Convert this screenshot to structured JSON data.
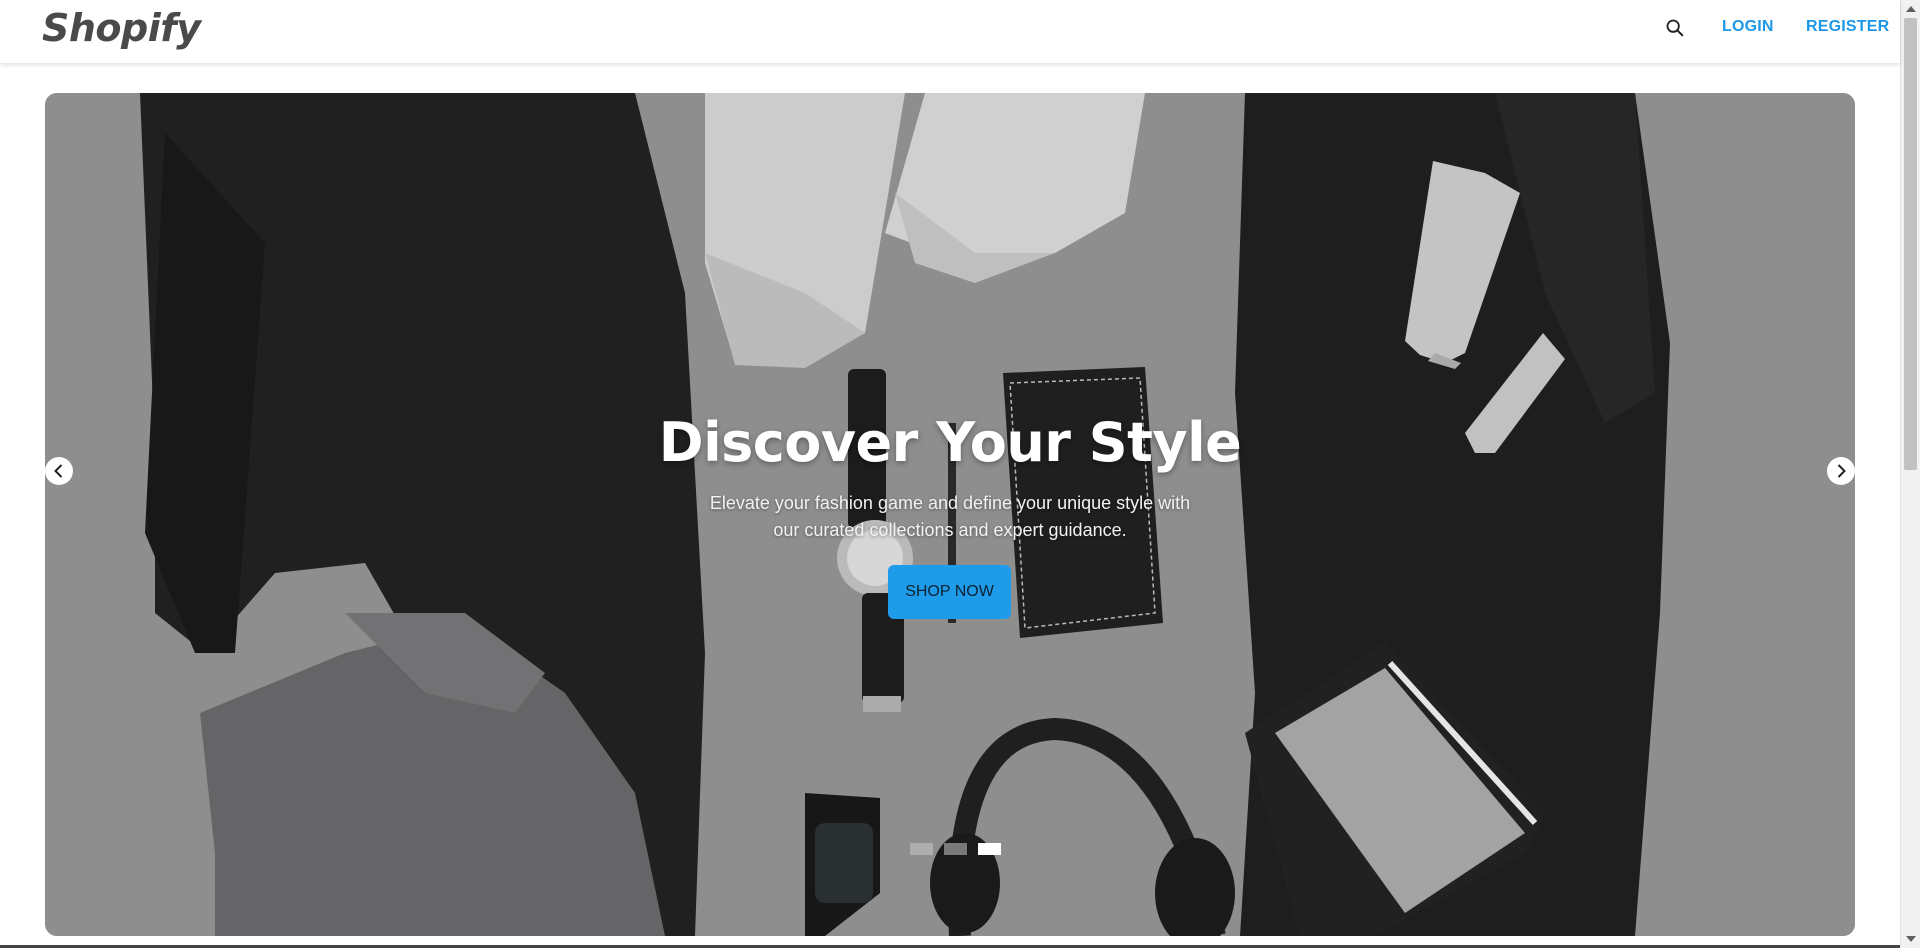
{
  "brand": {
    "logo_text": "Shopify"
  },
  "nav": {
    "search_icon": "search-icon",
    "login_label": "LOGIN",
    "register_label": "REGISTER",
    "link_color": "#1c98e6"
  },
  "hero": {
    "title": "Discover Your Style",
    "subtitle": "Elevate your fashion game and define your unique style with our curated collections and expert guidance.",
    "cta_label": "SHOP NOW",
    "cta_color": "#1e9be9",
    "prev_icon": "chevron-left-icon",
    "next_icon": "chevron-right-icon",
    "slides": [
      {
        "active": false
      },
      {
        "active": false
      },
      {
        "active": true
      }
    ],
    "image_description_icon": "flat-lay-fashion-photo"
  }
}
